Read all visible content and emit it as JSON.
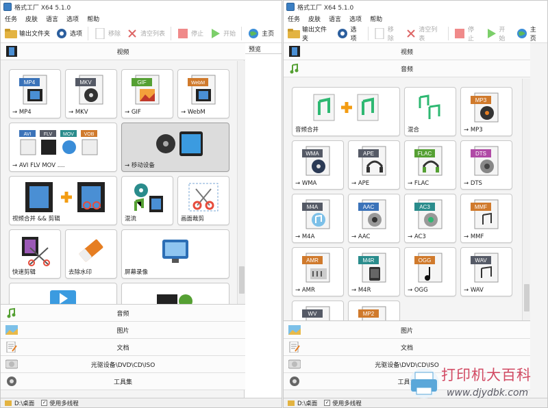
{
  "left": {
    "title": "格式工厂 X64 5.1.0",
    "menu": [
      "任务",
      "皮肤",
      "语言",
      "选项",
      "帮助"
    ],
    "toolbar": {
      "output_folder": "输出文件夹",
      "options": "选项",
      "remove": "移除",
      "clear_list": "清空列表",
      "stop": "停止",
      "start": "开始",
      "home": "主页"
    },
    "preview_label": "预览",
    "category_video": "视频",
    "tiles": {
      "mp4": {
        "badge": "MP4",
        "label": "→ MP4"
      },
      "mkv": {
        "badge": "MKV",
        "label": "→ MKV"
      },
      "gif": {
        "badge": "GIF",
        "label": "→ GIF"
      },
      "webm": {
        "badge": "WebM",
        "label": "→ WebM"
      },
      "multi": {
        "badges": [
          "AVI",
          "FLV",
          "MOV",
          "VOB"
        ],
        "label": "→ AVI FLV MOV ...."
      },
      "mobile": {
        "label": "→ 移动设备"
      },
      "merge": {
        "label": "视频合并 && 剪辑"
      },
      "mix": {
        "label": "混流"
      },
      "crop": {
        "label": "画面裁剪"
      },
      "fastcut": {
        "label": "快速剪辑"
      },
      "watermark": {
        "label": "去除水印"
      },
      "record": {
        "label": "屏幕录像"
      }
    },
    "categories_bottom": [
      "音频",
      "图片",
      "文档",
      "光驱设备\\DVD\\CD\\ISO",
      "工具集"
    ],
    "status": {
      "path": "D:\\桌面",
      "multithread": "使用多线程"
    }
  },
  "right": {
    "title": "格式工厂 X64 5.1.0",
    "menu": [
      "任务",
      "皮肤",
      "语言",
      "选项",
      "帮助"
    ],
    "toolbar": {
      "output_folder": "输出文件夹",
      "options": "选项",
      "remove": "移除",
      "clear_list": "清空列表",
      "stop": "停止",
      "start": "开始",
      "home": "主页"
    },
    "category_video": "视频",
    "category_audio": "音频",
    "tiles": {
      "audio_merge": {
        "label": "音频合并"
      },
      "mix": {
        "label": "混合"
      },
      "mp3": {
        "badge": "MP3",
        "label": "→ MP3"
      },
      "wma": {
        "badge": "WMA",
        "label": "→ WMA"
      },
      "ape": {
        "badge": "APE",
        "label": "→ APE"
      },
      "flac": {
        "badge": "FLAC",
        "label": "→ FLAC"
      },
      "dts": {
        "badge": "DTS",
        "label": "→ DTS"
      },
      "m4a": {
        "badge": "M4A",
        "label": "→ M4A"
      },
      "aac": {
        "badge": "AAC",
        "label": "→ AAC"
      },
      "ac3": {
        "badge": "AC3",
        "label": "→ AC3"
      },
      "mmf": {
        "badge": "MMF",
        "label": "→ MMF"
      },
      "amr": {
        "badge": "AMR",
        "label": "→ AMR"
      },
      "m4r": {
        "badge": "M4R",
        "label": "→ M4R"
      },
      "ogg": {
        "badge": "OGG",
        "label": "→ OGG"
      },
      "wav": {
        "badge": "WAV",
        "label": "→ WAV"
      },
      "wv": {
        "badge": "WV"
      },
      "mp2": {
        "badge": "MP2"
      }
    },
    "categories_bottom": [
      "图片",
      "文档",
      "光驱设备\\DVD\\CD\\ISO",
      "工具集"
    ],
    "status": {
      "path": "D:\\桌面",
      "multithread": "使用多线程"
    }
  },
  "watermark": {
    "text": "打印机大百科",
    "url": "www.djydbk.com"
  },
  "colors": {
    "badge_dark": "#555a66",
    "badge_blue": "#3b73b9",
    "badge_green": "#55a033",
    "badge_purple": "#b04aa6",
    "badge_orange": "#d07a2c",
    "badge_teal": "#2a8c8c",
    "badge_red": "#c0392b"
  }
}
